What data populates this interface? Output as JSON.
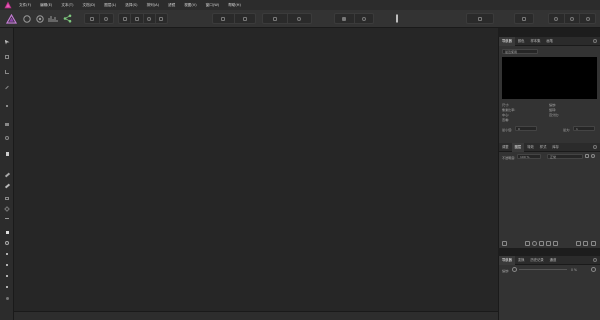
{
  "app": {
    "logo_icon": "affinity-logo-icon",
    "accent": "#c2328f"
  },
  "menu": [
    "文件(F)",
    "编辑(E)",
    "文本(T)",
    "文档(D)",
    "图层(L)",
    "选择(S)",
    "排列(A)",
    "滤镜",
    "视图(V)",
    "窗口(W)",
    "帮助(H)"
  ],
  "toolbar": {
    "left_icons": [
      "persona-designer-icon",
      "persona-pixel-icon",
      "persona-export-icon",
      "share-icon"
    ],
    "color": "#333333"
  },
  "navigator_panel": {
    "tabs": [
      "导航器",
      "颜色",
      "样本集",
      "画笔"
    ],
    "active_tab": 0,
    "dropdown": "最近使用",
    "rows": [
      {
        "left": "尺寸:",
        "right": "缩放:"
      },
      {
        "left": "像素比率:",
        "right": "旋转:"
      },
      {
        "left": "中心:",
        "right": "百分比:"
      },
      {
        "left": "查看:",
        "right": ""
      }
    ],
    "min_label": "最小值:",
    "min_value": "0",
    "max_label": "最大:",
    "max_value": "1"
  },
  "layers_panel": {
    "tabs": [
      "调整",
      "图层",
      "特效",
      "样式",
      "库存"
    ],
    "active_tab": 1,
    "opacity_label": "不透明度:",
    "opacity_value": "100 %",
    "blend_mode": "正常"
  },
  "history_panel": {
    "tabs": [
      "导航器",
      "变换",
      "历史记录",
      "通道"
    ],
    "active_tab": 0,
    "zoom_label": "缩放:",
    "zoom_value": "0 %"
  }
}
